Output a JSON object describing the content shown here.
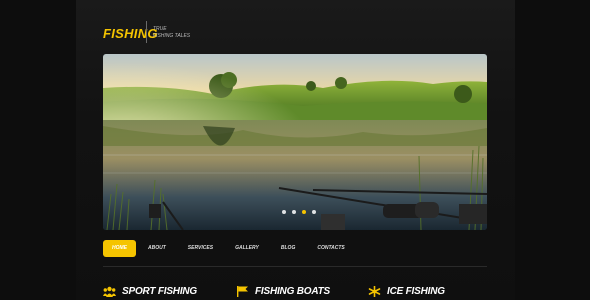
{
  "header": {
    "logo": "FISHING",
    "tagline_line1": "TRUE",
    "tagline_line2": "FISHING TALES"
  },
  "slider": {
    "image": "lake-sunset-fishing-rods",
    "slide_count": 4,
    "active_slide": 3
  },
  "nav": {
    "items": [
      {
        "label": "HOME",
        "active": true
      },
      {
        "label": "ABOUT",
        "active": false
      },
      {
        "label": "SERVICES",
        "active": false
      },
      {
        "label": "GALLERY",
        "active": false
      },
      {
        "label": "BLOG",
        "active": false
      },
      {
        "label": "CONTACTS",
        "active": false
      }
    ]
  },
  "features": [
    {
      "title": "SPORT FISHING",
      "icon": "group-people-icon"
    },
    {
      "title": "FISHING BOATS",
      "icon": "flag-icon"
    },
    {
      "title": "ICE FISHING",
      "icon": "snowflake-icon"
    }
  ],
  "colors": {
    "accent": "#f5c400",
    "background": "#0d0d0d",
    "panel": "#151515"
  }
}
